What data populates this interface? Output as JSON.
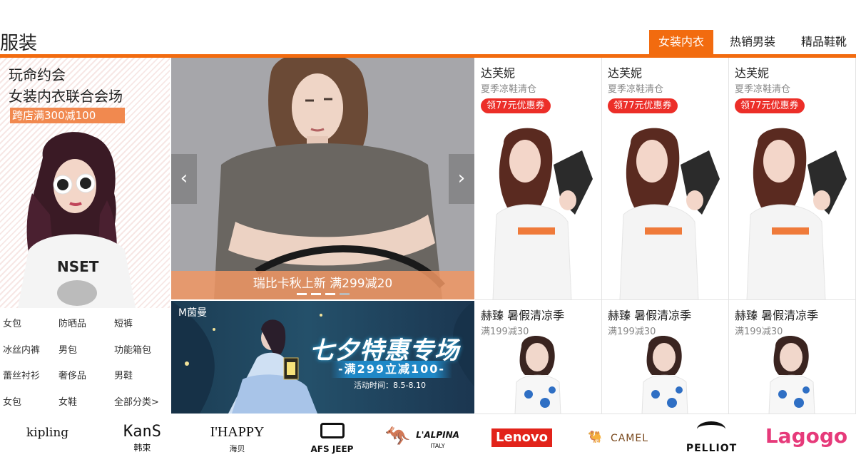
{
  "header": {
    "title": "服装",
    "tabs": [
      {
        "label": "女装内衣",
        "active": true
      },
      {
        "label": "热销男装",
        "active": false
      },
      {
        "label": "精品鞋靴",
        "active": false
      }
    ],
    "accent_color": "#f26b0f"
  },
  "left_promo": {
    "title": "玩命约会",
    "subtitle": "女装内衣联合会场",
    "tag": "跨店满300减100",
    "shirt_text": "NSET"
  },
  "categories": [
    [
      "女包",
      "防晒品",
      "短裤"
    ],
    [
      "冰丝内裤",
      "男包",
      "功能箱包"
    ],
    [
      "蕾丝衬衫",
      "奢侈品",
      "男鞋"
    ],
    [
      "女包",
      "女鞋",
      "全部分类>"
    ]
  ],
  "carousel": {
    "caption": "瑞比卡秋上新  满299减20",
    "prev_icon": "chevron-left-icon",
    "next_icon": "chevron-right-icon",
    "slide_count": 4,
    "active_slide": 1
  },
  "banner": {
    "brand": "M茵曼",
    "headline": "七夕特惠专场",
    "offer": "-满299立减100-",
    "date": "活动时间：8.5-8.10"
  },
  "products_top": [
    {
      "brand": "达芙妮",
      "subtitle": "夏季凉鞋清仓",
      "coupon": "领77元优惠券"
    },
    {
      "brand": "达芙妮",
      "subtitle": "夏季凉鞋清仓",
      "coupon": "领77元优惠券"
    },
    {
      "brand": "达芙妮",
      "subtitle": "夏季凉鞋清仓",
      "coupon": "领77元优惠券"
    }
  ],
  "products_bottom": [
    {
      "brand": "赫臻 暑假清凉季",
      "subtitle": "满199减30"
    },
    {
      "brand": "赫臻 暑假清凉季",
      "subtitle": "满199减30"
    },
    {
      "brand": "赫臻 暑假清凉季",
      "subtitle": "满199减30"
    }
  ],
  "brands": [
    {
      "name": "kipling",
      "sub": ""
    },
    {
      "name": "KanS",
      "sub": "韩束"
    },
    {
      "name": "I'HAPPY",
      "sub": "海贝"
    },
    {
      "name": "AFS JEEP",
      "sub": ""
    },
    {
      "name": "L'ALPINA",
      "sub": "ITALY"
    },
    {
      "name": "Lenovo",
      "sub": ""
    },
    {
      "name": "CAMEL",
      "sub": ""
    },
    {
      "name": "PELLIOT",
      "sub": ""
    },
    {
      "name": "Lagogo",
      "sub": ""
    }
  ]
}
